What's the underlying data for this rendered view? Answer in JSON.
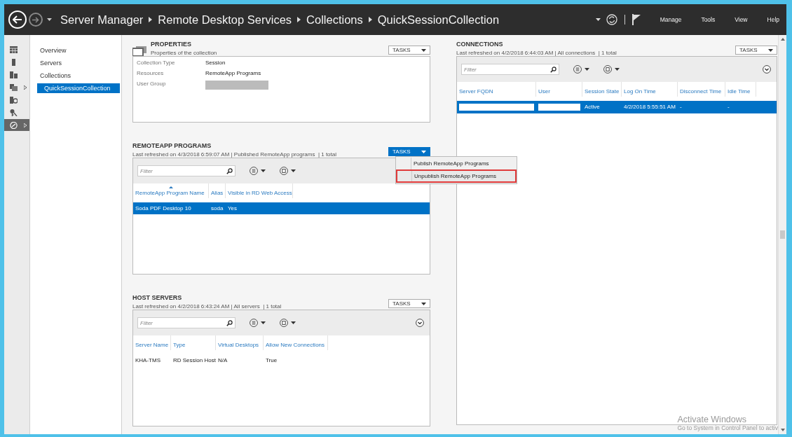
{
  "window": {
    "breadcrumb": [
      "Server Manager",
      "Remote Desktop Services",
      "Collections",
      "QuickSessionCollection"
    ],
    "menu": [
      "Manage",
      "Tools",
      "View",
      "Help"
    ]
  },
  "rail": [
    {
      "kind": "dashboard",
      "selected": false,
      "expandable": false
    },
    {
      "kind": "local",
      "selected": false,
      "expandable": false
    },
    {
      "kind": "all",
      "selected": false,
      "expandable": false
    },
    {
      "kind": "files",
      "selected": false,
      "expandable": true
    },
    {
      "kind": "iis",
      "selected": false,
      "expandable": false
    },
    {
      "kind": "keys",
      "selected": false,
      "expandable": false
    },
    {
      "kind": "rds",
      "selected": true,
      "expandable": true
    }
  ],
  "nav": [
    {
      "label": "Overview",
      "selected": false
    },
    {
      "label": "Servers",
      "selected": false
    },
    {
      "label": "Collections",
      "selected": false,
      "children": [
        {
          "label": "QuickSessionCollection",
          "selected": true
        }
      ]
    }
  ],
  "properties": {
    "title": "PROPERTIES",
    "subtitle": "Properties of the collection",
    "tasks": {
      "label": "TASKS",
      "open": false
    },
    "fields": [
      {
        "label": "Collection Type",
        "value": "Session"
      },
      {
        "label": "Resources",
        "value": "RemoteApp Programs"
      },
      {
        "label": "User Group",
        "redacted": true
      }
    ]
  },
  "remoteapp": {
    "title": "REMOTEAPP PROGRAMS",
    "status": "Last refreshed on 4/3/2018 6:59:07 AM | Published RemoteApp programs  | 1 total",
    "tasks": {
      "label": "TASKS",
      "open": true
    },
    "menu": [
      {
        "label": "Publish RemoteApp Programs",
        "highlighted": false
      },
      {
        "label": "Unpublish RemoteApp Programs",
        "highlighted": true
      }
    ],
    "filter": {
      "placeholder": "Filter"
    },
    "expand_button": false,
    "columns": [
      {
        "label": "RemoteApp Program Name",
        "sorted": true
      },
      {
        "label": "Alias",
        "sorted": false
      },
      {
        "label": "Visible in RD Web Access",
        "sorted": false
      }
    ],
    "rows": [
      {
        "cells": [
          "Soda PDF Desktop 10",
          "soda",
          "Yes"
        ],
        "selected": true
      }
    ]
  },
  "host_servers": {
    "title": "HOST SERVERS",
    "status": "Last refreshed on 4/2/2018 6:43:24 AM | All servers  | 1 total",
    "tasks": {
      "label": "TASKS",
      "open": false
    },
    "filter": {
      "placeholder": "Filter"
    },
    "expand_button": true,
    "columns": [
      {
        "label": "Server Name",
        "sorted": false
      },
      {
        "label": "Type",
        "sorted": false
      },
      {
        "label": "Virtual Desktops",
        "sorted": false
      },
      {
        "label": "Allow New Connections",
        "sorted": false
      }
    ],
    "rows": [
      {
        "cells": [
          "KHA-TMS",
          "RD Session Host",
          "N/A",
          "True"
        ],
        "selected": false
      }
    ]
  },
  "connections": {
    "title": "CONNECTIONS",
    "status": "Last refreshed on 4/2/2018 6:44:03 AM | All connections  | 1 total",
    "tasks": {
      "label": "TASKS",
      "open": false
    },
    "filter": {
      "placeholder": "Filter"
    },
    "expand_button": true,
    "columns": [
      {
        "label": "Server FQDN",
        "sorted": false
      },
      {
        "label": "User",
        "sorted": false
      },
      {
        "label": "Session State",
        "sorted": false
      },
      {
        "label": "Log On Time",
        "sorted": false
      },
      {
        "label": "Disconnect Time",
        "sorted": false
      },
      {
        "label": "Idle Time",
        "sorted": false
      }
    ],
    "rows": [
      {
        "cells": [
          null,
          null,
          "Active",
          "4/2/2018 5:55:51 AM",
          "-",
          "-"
        ],
        "selected": true
      }
    ]
  },
  "activation_notice": {
    "title": "Activate Windows",
    "text": "Go to System in Control Panel to activ"
  }
}
